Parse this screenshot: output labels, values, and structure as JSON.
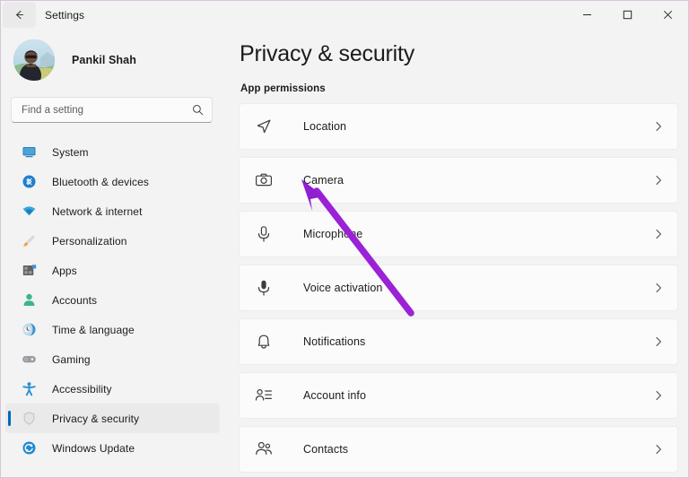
{
  "window": {
    "app_title": "Settings",
    "back_icon": "back-arrow-icon",
    "controls": {
      "minimize": "minimize-icon",
      "maximize": "maximize-icon",
      "close": "close-icon"
    }
  },
  "sidebar": {
    "account": {
      "name": "Pankil Shah",
      "avatar": "user-avatar-photo"
    },
    "search": {
      "placeholder": "Find a setting",
      "value": "",
      "icon": "search-icon"
    },
    "items": [
      {
        "label": "System",
        "icon": "system-monitor-icon",
        "selected": false
      },
      {
        "label": "Bluetooth & devices",
        "icon": "bluetooth-icon",
        "selected": false
      },
      {
        "label": "Network & internet",
        "icon": "wifi-icon",
        "selected": false
      },
      {
        "label": "Personalization",
        "icon": "paintbrush-icon",
        "selected": false
      },
      {
        "label": "Apps",
        "icon": "apps-grid-icon",
        "selected": false
      },
      {
        "label": "Accounts",
        "icon": "person-icon",
        "selected": false
      },
      {
        "label": "Time & language",
        "icon": "clock-globe-icon",
        "selected": false
      },
      {
        "label": "Gaming",
        "icon": "gamepad-icon",
        "selected": false
      },
      {
        "label": "Accessibility",
        "icon": "accessibility-person-icon",
        "selected": false
      },
      {
        "label": "Privacy & security",
        "icon": "shield-icon",
        "selected": true
      },
      {
        "label": "Windows Update",
        "icon": "update-refresh-icon",
        "selected": false
      }
    ]
  },
  "main": {
    "page_title": "Privacy & security",
    "section_heading": "App permissions",
    "permissions": [
      {
        "label": "Location",
        "icon": "location-arrow-icon",
        "chevron": "chevron-right-icon"
      },
      {
        "label": "Camera",
        "icon": "camera-icon",
        "chevron": "chevron-right-icon"
      },
      {
        "label": "Microphone",
        "icon": "microphone-outline-icon",
        "chevron": "chevron-right-icon"
      },
      {
        "label": "Voice activation",
        "icon": "microphone-filled-icon",
        "chevron": "chevron-right-icon"
      },
      {
        "label": "Notifications",
        "icon": "bell-icon",
        "chevron": "chevron-right-icon"
      },
      {
        "label": "Account info",
        "icon": "account-info-icon",
        "chevron": "chevron-right-icon"
      },
      {
        "label": "Contacts",
        "icon": "contacts-people-icon",
        "chevron": "chevron-right-icon"
      }
    ]
  },
  "annotation": {
    "type": "arrow",
    "target_label": "Camera",
    "color": "#9020d0"
  },
  "colors": {
    "accent": "#0067c0",
    "window_background": "#f3f3f3",
    "card_background": "#fbfbfb",
    "text_primary": "#1b1b1b",
    "window_border": "#d8c4da",
    "annotation_purple": "#9020d0"
  }
}
